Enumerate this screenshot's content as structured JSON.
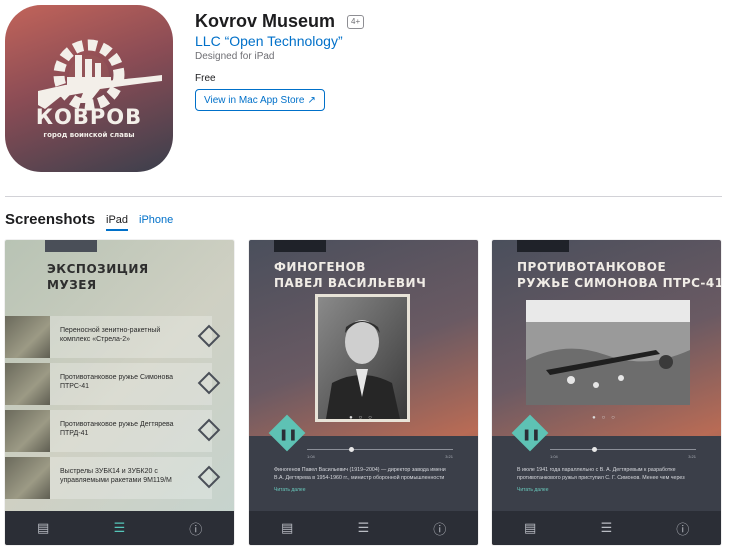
{
  "app": {
    "title": "Kovrov Museum",
    "age_rating": "4+",
    "developer": "LLC “Open Technology”",
    "designed_for": "Designed for iPad",
    "price": "Free",
    "store_button": "View in Mac App Store",
    "store_button_icon": "arrow-up-right-icon",
    "icon_text": "КОВРОВ",
    "icon_subtext": "город воинской славы"
  },
  "screenshots": {
    "title": "Screenshots",
    "tabs": [
      "iPad",
      "iPhone"
    ],
    "selected_tab": "iPad",
    "shot1": {
      "heading_line1": "ЭКСПОЗИЦИЯ",
      "heading_line2": "МУЗЕЯ",
      "items": [
        "Переносной зенитно-ракетный комплекс «Стрела-2»",
        "Противотанковое ружье Симонова ПТРС-41",
        "Противотанковое ружье Дегтярева ПТРД-41",
        "Выстрелы 3УБК14 и 3УБК20 с управляемыми ракетами 9М119/М"
      ]
    },
    "shot2": {
      "heading_line1": "ФИНОГЕНОВ",
      "heading_line2": "ПАВЕЛ ВАСИЛЬЕВИЧ",
      "time_start": "1:04",
      "time_end": "3:21",
      "body": "Финогенов Павел Васильевич (1919–2004) — директор завода имени В.А. Дегтярева в 1954-1960 гг., министр оборонной промышленности",
      "more": "Читать далее"
    },
    "shot3": {
      "heading_line1": "ПРОТИВОТАНКОВОЕ",
      "heading_line2": "РУЖЬЕ СИМОНОВА ПТРС-41",
      "time_start": "1:04",
      "time_end": "3:21",
      "body": "В июле 1941 года параллельно с В. А. Дегтяревым к разработке противотанкового ружья приступил С. Г. Симонов. Менее чем через",
      "more": "Читать далее"
    },
    "tabbar_icons": [
      "tray-icon",
      "list-icon",
      "info-icon"
    ]
  },
  "colors": {
    "link": "#0070c9",
    "accent_teal": "#5ec2b4"
  }
}
